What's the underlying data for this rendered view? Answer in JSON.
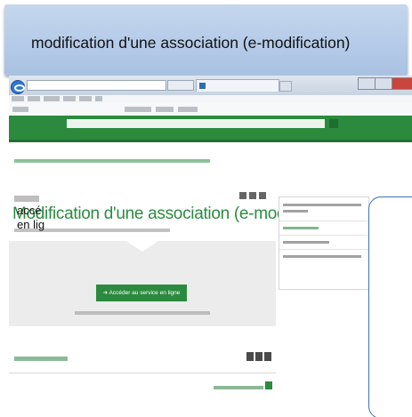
{
  "slide": {
    "title": "modification d'une association (e-modification)"
  },
  "browser": {
    "icon": "internet-explorer-icon",
    "window_controls": [
      "minimize-icon",
      "maximize-icon",
      "close-icon"
    ]
  },
  "site": {
    "header_color": "#2b8a3e",
    "page_title": "Modification d'une association (e-modification)",
    "cta_label": "Accéder au service en ligne",
    "cta_icon": "arrow-right-icon",
    "share_icons": [
      "print-icon",
      "facebook-icon",
      "twitter-icon"
    ],
    "social_icons": [
      "facebook-icon",
      "twitter-icon",
      "google-plus-icon"
    ],
    "top_icon": "arrow-up-icon"
  },
  "callout": {
    "line1": "accé",
    "line2": "en lig"
  },
  "colors": {
    "title_banner": "#b5cbe8",
    "accent_green": "#2b8a3e",
    "callout_border": "#3f71b0"
  }
}
